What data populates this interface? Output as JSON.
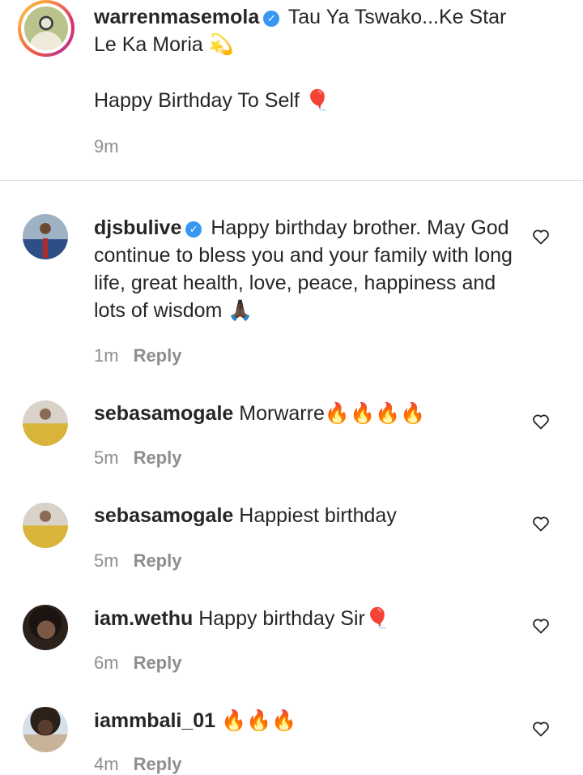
{
  "caption": {
    "username": "warrenmasemola",
    "text_line1": "Tau Ya Tswako...Ke Star",
    "text_line2": "Le Ka Moria",
    "sparkle_emoji": "💫",
    "text_line3": "Happy Birthday To Self",
    "balloon_emoji": "🎈",
    "time": "9m"
  },
  "comments": [
    {
      "username": "djsbulive",
      "verified": true,
      "text": "Happy birthday brother. May God continue to bless you and your family with long life, great health, love, peace, happiness and lots of wisdom 🙏🏿",
      "time": "1m",
      "reply": "Reply"
    },
    {
      "username": "sebasamogale",
      "text": "Morwarre🔥🔥🔥🔥",
      "time": "5m",
      "reply": "Reply"
    },
    {
      "username": "sebasamogale",
      "text": "Happiest birthday",
      "time": "5m",
      "reply": "Reply"
    },
    {
      "username": "iam.wethu",
      "text": "Happy birthday Sir🎈",
      "time": "6m",
      "reply": "Reply"
    },
    {
      "username": "iammbali_01",
      "text": " 🔥🔥🔥",
      "time": "4m",
      "reply": "Reply"
    }
  ],
  "icons": {
    "verified": "verified-badge-icon",
    "like": "heart-outline-icon"
  },
  "colors": {
    "verified": "#3897f0",
    "meta_text": "#8e8e8e",
    "divider": "#dbdbdb"
  }
}
